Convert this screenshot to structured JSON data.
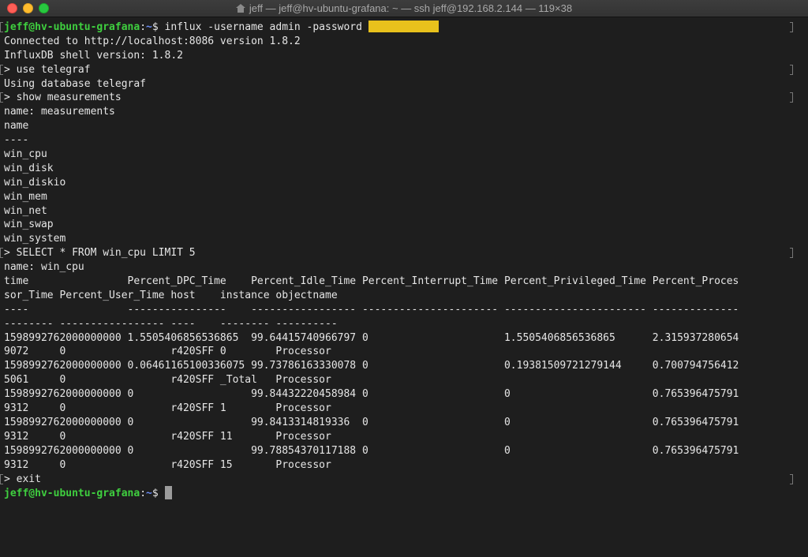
{
  "window": {
    "title": "jeff — jeff@hv-ubuntu-grafana: ~ — ssh jeff@192.168.2.144 — 119×38",
    "title_icon": "home-folder-icon"
  },
  "prompt": {
    "user_host": "jeff@hv-ubuntu-grafana",
    "path": "~",
    "symbol": "$ "
  },
  "session": {
    "login_command": "influx -username admin -password",
    "connected": "Connected to http://localhost:8086 version 1.8.2",
    "shell_version": "InfluxDB shell version: 1.8.2",
    "cmd_use": "> use telegraf",
    "using_db": "Using database telegraf",
    "cmd_show": "> show measurements",
    "name_measurements": "name: measurements",
    "col_name": "name",
    "col_name_sep": "----",
    "measurements": [
      "win_cpu",
      "win_disk",
      "win_diskio",
      "win_mem",
      "win_net",
      "win_swap",
      "win_system"
    ],
    "cmd_select": "> SELECT * FROM win_cpu LIMIT 5",
    "name_win_cpu": "name: win_cpu",
    "table_header_1": "time                Percent_DPC_Time    Percent_Idle_Time Percent_Interrupt_Time Percent_Privileged_Time Percent_Proces",
    "table_header_2": "sor_Time Percent_User_Time host    instance objectname",
    "table_sep_1": "----                ----------------    ----------------- ---------------------- ----------------------- --------------",
    "table_sep_2": "-------- ----------------- ----    -------- ----------",
    "rows": [
      {
        "a": "1598992762000000000 1.5505406856536865  99.64415740966797 0                      1.5505406856536865      2.315937280654",
        "b": "9072     0                 r420SFF 0        Processor"
      },
      {
        "a": "1598992762000000000 0.06461165100336075 99.73786163330078 0                      0.19381509721279144     0.700794756412",
        "b": "5061     0                 r420SFF _Total   Processor"
      },
      {
        "a": "1598992762000000000 0                   99.84432220458984 0                      0                       0.765396475791",
        "b": "9312     0                 r420SFF 1        Processor"
      },
      {
        "a": "1598992762000000000 0                   99.8413314819336  0                      0                       0.765396475791",
        "b": "9312     0                 r420SFF 11       Processor"
      },
      {
        "a": "1598992762000000000 0                   99.78854370117188 0                      0                       0.765396475791",
        "b": "9312     0                 r420SFF 15       Processor"
      }
    ],
    "cmd_exit": "> exit"
  },
  "colors": {
    "background": "#1e1e1e",
    "text": "#e6e6e6",
    "prompt_host": "#3fcf3f",
    "prompt_path": "#6b8cf5",
    "redaction": "#e8c11c"
  }
}
